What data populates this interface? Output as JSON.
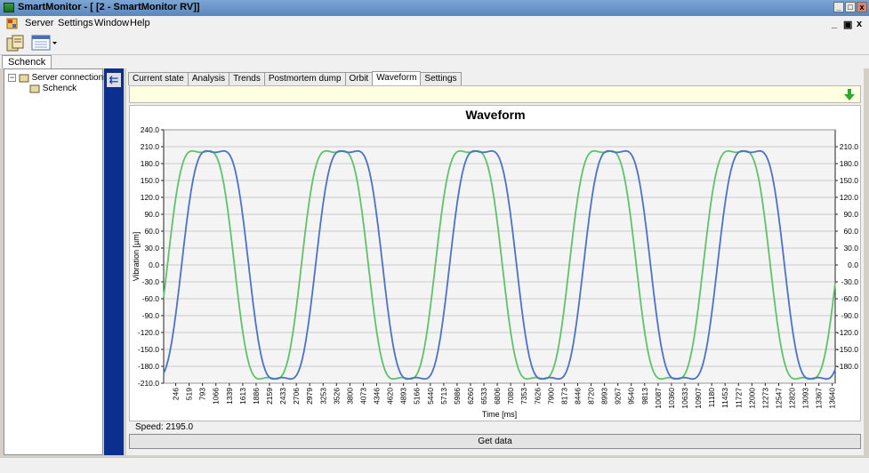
{
  "window": {
    "title": "SmartMonitor - [ [2 - SmartMonitor RV]]",
    "controls": [
      "_",
      "□",
      "x"
    ]
  },
  "menu": {
    "items": [
      "Server",
      "Settings",
      "Window",
      "Help"
    ],
    "mdi_controls": [
      "_",
      "▣",
      "x"
    ]
  },
  "toolbar": {
    "buttons": [
      "server-icon",
      "layout-icon"
    ]
  },
  "session_tab": {
    "label": "Schenck"
  },
  "tree": {
    "root": "Server connections",
    "child": "Schenck"
  },
  "tabs": [
    {
      "label": "Current state"
    },
    {
      "label": "Analysis"
    },
    {
      "label": "Trends"
    },
    {
      "label": "Postmortem dump"
    },
    {
      "label": "Orbit"
    },
    {
      "label": "Waveform",
      "active": true
    },
    {
      "label": "Settings"
    }
  ],
  "speed": {
    "label": "Speed: 2195.0"
  },
  "get_data": {
    "label": "Get data"
  },
  "chart_data": {
    "type": "line",
    "title": "Waveform",
    "xlabel": "Time [ms]",
    "ylabel": "Vibration [µm]",
    "ylim": [
      -210,
      240
    ],
    "y_ticks": [
      "240.0",
      "210.0",
      "180.0",
      "150.0",
      "120.0",
      "90.0",
      "60.0",
      "30.0",
      "0.0",
      "-30.0",
      "-60.0",
      "-90.0",
      "-120.0",
      "-150.0",
      "-180.0",
      "-210.0"
    ],
    "y2_ticks": [
      "210.0",
      "180.0",
      "150.0",
      "120.0",
      "90.0",
      "60.0",
      "30.0",
      "0.0",
      "-30.0",
      "-60.0",
      "-90.0",
      "-120.0",
      "-150.0",
      "-180.0"
    ],
    "x_ticks": [
      "246",
      "519",
      "793",
      "1066",
      "1339",
      "1613",
      "1886",
      "2159",
      "2433",
      "2706",
      "2979",
      "3253",
      "3526",
      "3800",
      "4073",
      "4346",
      "4620",
      "4893",
      "5166",
      "5440",
      "5713",
      "5986",
      "6260",
      "6533",
      "6806",
      "7080",
      "7353",
      "7626",
      "7900",
      "8173",
      "8446",
      "8720",
      "8993",
      "9267",
      "9540",
      "9813",
      "10087",
      "10360",
      "10633",
      "10907",
      "11180",
      "11453",
      "11727",
      "12000",
      "12273",
      "12547",
      "12820",
      "13093",
      "13367",
      "13640"
    ],
    "xlim": [
      0,
      13700
    ],
    "grid": true,
    "series": [
      {
        "color": "#5ec26a",
        "amplitude": 200,
        "period_ms": 2733,
        "peak_ms": 760,
        "harmonic_ratio": 0.14
      },
      {
        "color": "#4a72c8",
        "amplitude": 200,
        "period_ms": 2733,
        "peak_ms": 1050,
        "harmonic_ratio": 0.14
      }
    ]
  }
}
